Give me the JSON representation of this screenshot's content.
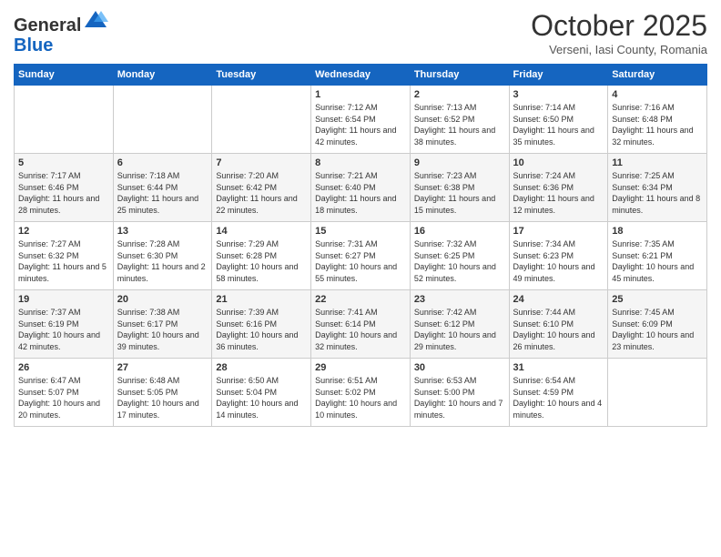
{
  "header": {
    "logo_general": "General",
    "logo_blue": "Blue",
    "month_title": "October 2025",
    "subtitle": "Verseni, Iasi County, Romania"
  },
  "days_of_week": [
    "Sunday",
    "Monday",
    "Tuesday",
    "Wednesday",
    "Thursday",
    "Friday",
    "Saturday"
  ],
  "weeks": [
    [
      {
        "day": "",
        "sunrise": "",
        "sunset": "",
        "daylight": ""
      },
      {
        "day": "",
        "sunrise": "",
        "sunset": "",
        "daylight": ""
      },
      {
        "day": "",
        "sunrise": "",
        "sunset": "",
        "daylight": ""
      },
      {
        "day": "1",
        "sunrise": "Sunrise: 7:12 AM",
        "sunset": "Sunset: 6:54 PM",
        "daylight": "Daylight: 11 hours and 42 minutes."
      },
      {
        "day": "2",
        "sunrise": "Sunrise: 7:13 AM",
        "sunset": "Sunset: 6:52 PM",
        "daylight": "Daylight: 11 hours and 38 minutes."
      },
      {
        "day": "3",
        "sunrise": "Sunrise: 7:14 AM",
        "sunset": "Sunset: 6:50 PM",
        "daylight": "Daylight: 11 hours and 35 minutes."
      },
      {
        "day": "4",
        "sunrise": "Sunrise: 7:16 AM",
        "sunset": "Sunset: 6:48 PM",
        "daylight": "Daylight: 11 hours and 32 minutes."
      }
    ],
    [
      {
        "day": "5",
        "sunrise": "Sunrise: 7:17 AM",
        "sunset": "Sunset: 6:46 PM",
        "daylight": "Daylight: 11 hours and 28 minutes."
      },
      {
        "day": "6",
        "sunrise": "Sunrise: 7:18 AM",
        "sunset": "Sunset: 6:44 PM",
        "daylight": "Daylight: 11 hours and 25 minutes."
      },
      {
        "day": "7",
        "sunrise": "Sunrise: 7:20 AM",
        "sunset": "Sunset: 6:42 PM",
        "daylight": "Daylight: 11 hours and 22 minutes."
      },
      {
        "day": "8",
        "sunrise": "Sunrise: 7:21 AM",
        "sunset": "Sunset: 6:40 PM",
        "daylight": "Daylight: 11 hours and 18 minutes."
      },
      {
        "day": "9",
        "sunrise": "Sunrise: 7:23 AM",
        "sunset": "Sunset: 6:38 PM",
        "daylight": "Daylight: 11 hours and 15 minutes."
      },
      {
        "day": "10",
        "sunrise": "Sunrise: 7:24 AM",
        "sunset": "Sunset: 6:36 PM",
        "daylight": "Daylight: 11 hours and 12 minutes."
      },
      {
        "day": "11",
        "sunrise": "Sunrise: 7:25 AM",
        "sunset": "Sunset: 6:34 PM",
        "daylight": "Daylight: 11 hours and 8 minutes."
      }
    ],
    [
      {
        "day": "12",
        "sunrise": "Sunrise: 7:27 AM",
        "sunset": "Sunset: 6:32 PM",
        "daylight": "Daylight: 11 hours and 5 minutes."
      },
      {
        "day": "13",
        "sunrise": "Sunrise: 7:28 AM",
        "sunset": "Sunset: 6:30 PM",
        "daylight": "Daylight: 11 hours and 2 minutes."
      },
      {
        "day": "14",
        "sunrise": "Sunrise: 7:29 AM",
        "sunset": "Sunset: 6:28 PM",
        "daylight": "Daylight: 10 hours and 58 minutes."
      },
      {
        "day": "15",
        "sunrise": "Sunrise: 7:31 AM",
        "sunset": "Sunset: 6:27 PM",
        "daylight": "Daylight: 10 hours and 55 minutes."
      },
      {
        "day": "16",
        "sunrise": "Sunrise: 7:32 AM",
        "sunset": "Sunset: 6:25 PM",
        "daylight": "Daylight: 10 hours and 52 minutes."
      },
      {
        "day": "17",
        "sunrise": "Sunrise: 7:34 AM",
        "sunset": "Sunset: 6:23 PM",
        "daylight": "Daylight: 10 hours and 49 minutes."
      },
      {
        "day": "18",
        "sunrise": "Sunrise: 7:35 AM",
        "sunset": "Sunset: 6:21 PM",
        "daylight": "Daylight: 10 hours and 45 minutes."
      }
    ],
    [
      {
        "day": "19",
        "sunrise": "Sunrise: 7:37 AM",
        "sunset": "Sunset: 6:19 PM",
        "daylight": "Daylight: 10 hours and 42 minutes."
      },
      {
        "day": "20",
        "sunrise": "Sunrise: 7:38 AM",
        "sunset": "Sunset: 6:17 PM",
        "daylight": "Daylight: 10 hours and 39 minutes."
      },
      {
        "day": "21",
        "sunrise": "Sunrise: 7:39 AM",
        "sunset": "Sunset: 6:16 PM",
        "daylight": "Daylight: 10 hours and 36 minutes."
      },
      {
        "day": "22",
        "sunrise": "Sunrise: 7:41 AM",
        "sunset": "Sunset: 6:14 PM",
        "daylight": "Daylight: 10 hours and 32 minutes."
      },
      {
        "day": "23",
        "sunrise": "Sunrise: 7:42 AM",
        "sunset": "Sunset: 6:12 PM",
        "daylight": "Daylight: 10 hours and 29 minutes."
      },
      {
        "day": "24",
        "sunrise": "Sunrise: 7:44 AM",
        "sunset": "Sunset: 6:10 PM",
        "daylight": "Daylight: 10 hours and 26 minutes."
      },
      {
        "day": "25",
        "sunrise": "Sunrise: 7:45 AM",
        "sunset": "Sunset: 6:09 PM",
        "daylight": "Daylight: 10 hours and 23 minutes."
      }
    ],
    [
      {
        "day": "26",
        "sunrise": "Sunrise: 6:47 AM",
        "sunset": "Sunset: 5:07 PM",
        "daylight": "Daylight: 10 hours and 20 minutes."
      },
      {
        "day": "27",
        "sunrise": "Sunrise: 6:48 AM",
        "sunset": "Sunset: 5:05 PM",
        "daylight": "Daylight: 10 hours and 17 minutes."
      },
      {
        "day": "28",
        "sunrise": "Sunrise: 6:50 AM",
        "sunset": "Sunset: 5:04 PM",
        "daylight": "Daylight: 10 hours and 14 minutes."
      },
      {
        "day": "29",
        "sunrise": "Sunrise: 6:51 AM",
        "sunset": "Sunset: 5:02 PM",
        "daylight": "Daylight: 10 hours and 10 minutes."
      },
      {
        "day": "30",
        "sunrise": "Sunrise: 6:53 AM",
        "sunset": "Sunset: 5:00 PM",
        "daylight": "Daylight: 10 hours and 7 minutes."
      },
      {
        "day": "31",
        "sunrise": "Sunrise: 6:54 AM",
        "sunset": "Sunset: 4:59 PM",
        "daylight": "Daylight: 10 hours and 4 minutes."
      },
      {
        "day": "",
        "sunrise": "",
        "sunset": "",
        "daylight": ""
      }
    ]
  ]
}
